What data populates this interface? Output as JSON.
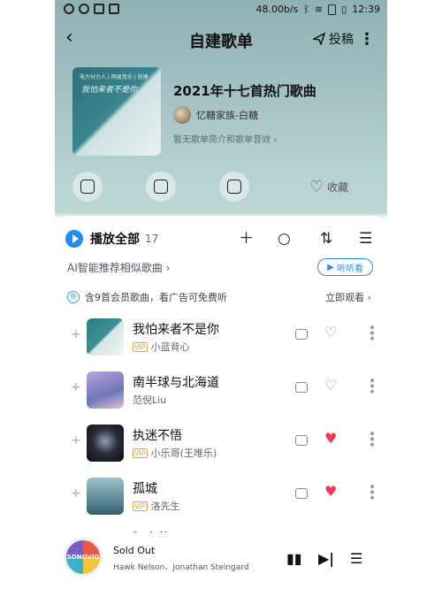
{
  "status_bar": {
    "speed": "48.00b/s",
    "time": "12:39"
  },
  "header": {
    "title": "自建歌单",
    "contribute": "投稿"
  },
  "playlist": {
    "title": "2021年十七首热门歌曲",
    "creator": "忆糖家族-白糖",
    "description": "暂无歌单简介和歌单音效",
    "cover_caption": "电力分力人 | 网易音乐 | 创建",
    "cover_script": "我怕来者不是你"
  },
  "actions": {
    "collect": "收藏"
  },
  "list": {
    "play_all": "播放全部",
    "count": "17",
    "ai_recommend": "AI智能推荐相似歌曲",
    "listen": "听听看",
    "vip_notice": "含9首会员歌曲，看广告可免费听",
    "vip_badge": "免",
    "watch_now": "立即观看",
    "songs": [
      {
        "name": "我怕来者不是你",
        "artist": "小蓝背心",
        "vip": "VIP",
        "liked": false
      },
      {
        "name": "南半球与北海道",
        "artist": "范倪Liu",
        "vip": "",
        "liked": false
      },
      {
        "name": "执迷不悟",
        "artist": "小乐哥(王唯乐)",
        "vip": "VIP",
        "liked": true
      },
      {
        "name": "孤城",
        "artist": "洛先生",
        "vip": "VIP",
        "liked": true
      }
    ],
    "peek_song": "阿衣莫"
  },
  "player": {
    "song": "Sold Out",
    "artist": "Hawk Nelson、Jonathan Steingard",
    "disc_label": "SONOVIO"
  },
  "colors": {
    "accent": "#1f8ef1",
    "liked": "#ee3b5b",
    "vip": "#e2a43b"
  }
}
